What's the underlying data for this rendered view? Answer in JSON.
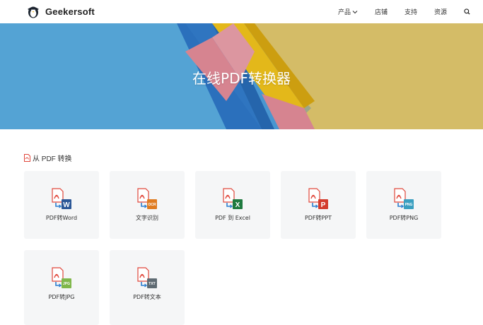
{
  "header": {
    "brand": "Geekersoft",
    "nav": [
      {
        "label": "产品",
        "icon": "chevron-down-icon"
      },
      {
        "label": "店铺"
      },
      {
        "label": "支持"
      },
      {
        "label": "资源"
      }
    ],
    "search_icon": "search-icon"
  },
  "hero": {
    "title": "在线PDF转换器",
    "colors": {
      "blue": "#58aee0",
      "yellow": "#e3c86d",
      "pencil_blue": "#2f78c9",
      "pencil_yellow": "#f3c81d",
      "pencil_pink": "#e58a98"
    }
  },
  "section": {
    "title": "从 PDF 转换",
    "icon": "pdf-file-icon"
  },
  "tools": [
    {
      "label": "PDF转Word",
      "badge": "W",
      "badge_color": "#2b5797"
    },
    {
      "label": "文字识别",
      "badge": "OCR",
      "badge_color": "#e07b20"
    },
    {
      "label": "PDF 到 Excel",
      "badge": "X",
      "badge_color": "#1f7a3f"
    },
    {
      "label": "PDF转PPT",
      "badge": "P",
      "badge_color": "#d33b2c"
    },
    {
      "label": "PDF转PNG",
      "badge": "PNG",
      "badge_color": "#3a9fc0"
    },
    {
      "label": "PDF转JPG",
      "badge": "JPG",
      "badge_color": "#7fb74a"
    },
    {
      "label": "PDF转文本",
      "badge": "TXT",
      "badge_color": "#5f6b73"
    }
  ],
  "accent": {
    "pdf_red": "#e0463a",
    "arrow_blue": "#2d7fd0"
  }
}
